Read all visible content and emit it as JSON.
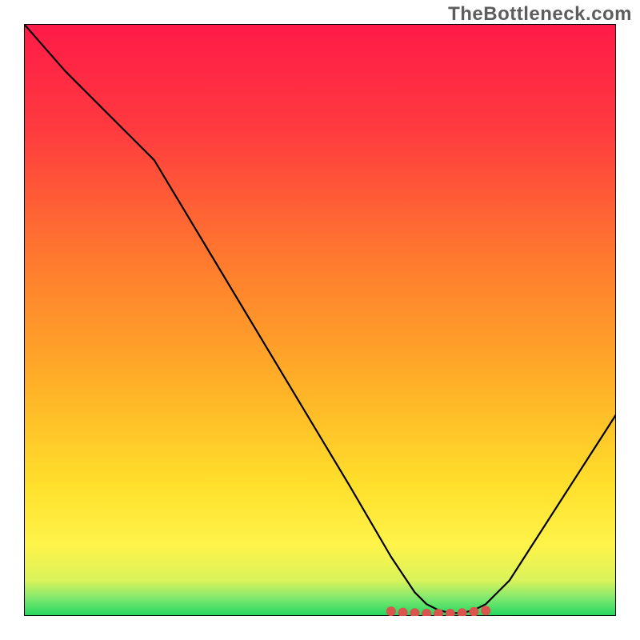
{
  "watermark": "TheBottleneck.com",
  "chart_data": {
    "type": "line",
    "title": "",
    "xlabel": "",
    "ylabel": "",
    "xlim": [
      0,
      100
    ],
    "ylim": [
      0,
      100
    ],
    "grid": false,
    "legend": false,
    "series": [
      {
        "name": "bottleneck-curve",
        "x": [
          0,
          7,
          20,
          22,
          55,
          62,
          66,
          68,
          70,
          72,
          74,
          76,
          78,
          80,
          82,
          100
        ],
        "values": [
          100,
          92,
          79,
          77,
          22,
          10,
          4,
          2,
          1,
          0.5,
          0.5,
          1,
          2,
          4,
          6,
          34
        ]
      }
    ],
    "markers": {
      "name": "bottleneck-zone",
      "color": "#d9544d",
      "x": [
        62,
        64,
        66,
        68,
        70,
        72,
        74,
        76,
        78
      ],
      "values": [
        0.8,
        0.6,
        0.5,
        0.4,
        0.4,
        0.4,
        0.5,
        0.7,
        0.9
      ]
    },
    "gradient_stops": [
      {
        "offset": 0,
        "color": "#ff1a48"
      },
      {
        "offset": 18,
        "color": "#ff3b3f"
      },
      {
        "offset": 40,
        "color": "#ff7a2e"
      },
      {
        "offset": 62,
        "color": "#ffb327"
      },
      {
        "offset": 78,
        "color": "#ffe02b"
      },
      {
        "offset": 88,
        "color": "#fff34a"
      },
      {
        "offset": 94,
        "color": "#d9f35a"
      },
      {
        "offset": 97,
        "color": "#7fe86f"
      },
      {
        "offset": 100,
        "color": "#1fd65f"
      }
    ]
  }
}
